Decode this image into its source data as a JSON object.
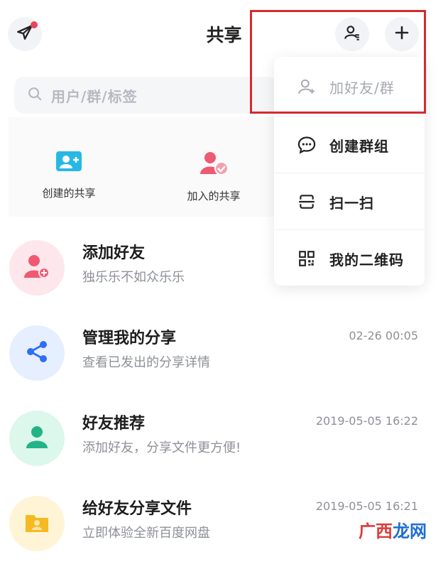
{
  "header": {
    "title": "共享"
  },
  "search": {
    "placeholder": "用户/群/标签"
  },
  "quick_actions": [
    {
      "label": "创建的共享",
      "icon": "create-share-icon"
    },
    {
      "label": "加入的共享",
      "icon": "joined-share-icon"
    }
  ],
  "list": [
    {
      "name": "添加好友",
      "sub": "独乐乐不如众乐乐",
      "time": "",
      "icon": "add-friend-icon",
      "color": "#fde7ec"
    },
    {
      "name": "管理我的分享",
      "sub": "查看已发出的分享详情",
      "time": "02-26 00:05",
      "icon": "share-icon",
      "color": "#e6efff"
    },
    {
      "name": "好友推荐",
      "sub": "添加好友，分享文件更方便!",
      "time": "2019-05-05 16:22",
      "icon": "friend-recommend-icon",
      "color": "#dcf7ec"
    },
    {
      "name": "给好友分享文件",
      "sub": "立即体验全新百度网盘",
      "time": "2019-05-05 16:21",
      "icon": "folder-share-icon",
      "color": "#fff4d6"
    }
  ],
  "dropdown": [
    {
      "label": "加好友/群",
      "icon": "add-friend-group-icon"
    },
    {
      "label": "创建群组",
      "icon": "chat-bubble-icon"
    },
    {
      "label": "扫一扫",
      "icon": "scan-icon"
    },
    {
      "label": "我的二维码",
      "icon": "qr-code-icon"
    }
  ],
  "watermark": {
    "part1": "广西",
    "part2": "龙网"
  },
  "colors": {
    "highlight": "#d42a2f",
    "badge": "#e9455a"
  }
}
